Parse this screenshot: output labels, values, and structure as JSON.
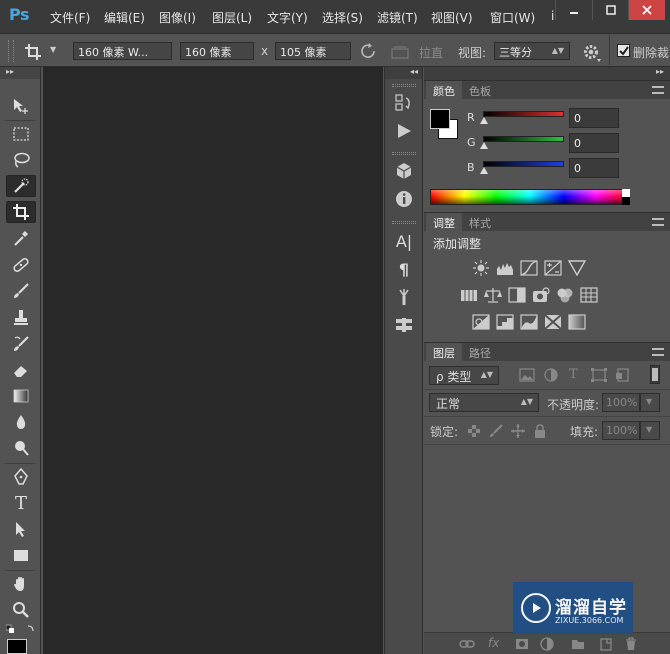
{
  "app": {
    "logo": "Ps"
  },
  "menu": [
    {
      "label": "文件(F)"
    },
    {
      "label": "编辑(E)"
    },
    {
      "label": "图像(I)"
    },
    {
      "label": "图层(L)"
    },
    {
      "label": "文字(Y)"
    },
    {
      "label": "选择(S)"
    },
    {
      "label": "滤镜(T)"
    },
    {
      "label": "视图(V)"
    },
    {
      "label": "窗口(W)"
    },
    {
      "label": "i"
    }
  ],
  "options": {
    "ratio_preset": "160 像素  W...",
    "width_value": "160 像素",
    "x_label": "x",
    "height_value": "105 像素",
    "straighten_label": "拉直",
    "view_label": "视图:",
    "view_value": "三等分",
    "delete_crop_label": "删除裁"
  },
  "tools": {
    "names": [
      "move-tool",
      "marquee-tool",
      "lasso-tool",
      "quick-select-tool",
      "crop-tool",
      "eyedropper-tool",
      "healing-brush-tool",
      "brush-tool",
      "clone-stamp-tool",
      "history-brush-tool",
      "eraser-tool",
      "gradient-tool",
      "blur-tool",
      "dodge-tool",
      "pen-tool",
      "type-tool",
      "path-select-tool",
      "shape-tool",
      "hand-tool",
      "zoom-tool"
    ],
    "type_glyph": "T"
  },
  "dock": {
    "char_glyph": "A|",
    "para_glyph": "¶"
  },
  "color_panel": {
    "tabs": [
      "颜色",
      "色板"
    ],
    "channels": [
      {
        "label": "R",
        "value": "0",
        "color": "#e03030"
      },
      {
        "label": "G",
        "value": "0",
        "color": "#30c040"
      },
      {
        "label": "B",
        "value": "0",
        "color": "#2040e0"
      }
    ]
  },
  "adjust_panel": {
    "tabs": [
      "调整",
      "样式"
    ],
    "title": "添加调整"
  },
  "layers_panel": {
    "tabs": [
      "图层",
      "路径"
    ],
    "filter_kind": "ρ 类型",
    "blend_mode": "正常",
    "opacity_label": "不透明度:",
    "opacity_value": "100%",
    "lock_label": "锁定:",
    "fill_label": "填充:",
    "fill_value": "100%",
    "footer_fx": "fx"
  },
  "watermark": {
    "title": "溜溜自学",
    "url": "ZIXUE.3066.COM"
  }
}
